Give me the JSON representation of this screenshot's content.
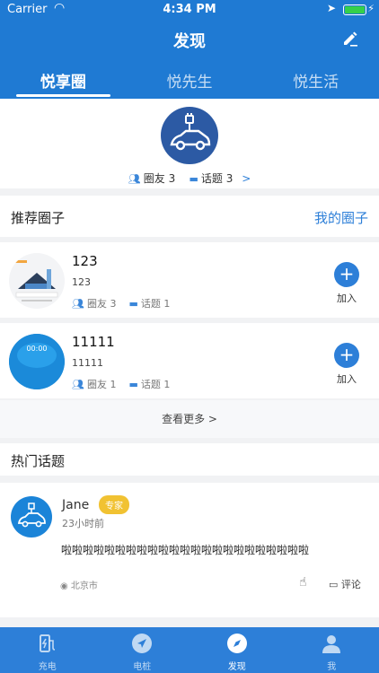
{
  "status": {
    "carrier": "Carrier",
    "time": "4:34 PM"
  },
  "header": {
    "title": "发现"
  },
  "tabs": [
    "悦享圈",
    "悦先生",
    "悦生活"
  ],
  "hero": {
    "members_label": "圈友",
    "members_count": "3",
    "topics_label": "话题",
    "topics_count": "3",
    "more_arrow": ">"
  },
  "recommend": {
    "title": "推荐圈子",
    "my_link": "我的圈子"
  },
  "circles": [
    {
      "name": "123",
      "desc": "123",
      "members": "圈友 3",
      "topics": "话题 1",
      "join_label": "加入"
    },
    {
      "name": "11111",
      "desc": "11111",
      "members": "圈友 1",
      "topics": "话题 1",
      "join_label": "加入",
      "thumb_text": "00:00"
    }
  ],
  "more_link": "查看更多 >",
  "hot": {
    "title": "热门话题"
  },
  "post": {
    "user": "Jane",
    "badge": "专家",
    "time": "23小时前",
    "text": "啦啦啦啦啦啦啦啦啦啦啦啦啦啦啦啦啦啦啦啦啦啦啦",
    "location": "北京市",
    "comment_label": "评论"
  },
  "tabbar": [
    {
      "label": "充电",
      "icon": "charging-station-icon"
    },
    {
      "label": "电桩",
      "icon": "navigation-icon"
    },
    {
      "label": "发现",
      "icon": "compass-icon",
      "active": true
    },
    {
      "label": "我",
      "icon": "user-icon"
    }
  ],
  "colors": {
    "primary": "#1f7ad3",
    "tabbar": "#2d7fd8",
    "badge": "#f1c232",
    "battery": "#35d04b"
  }
}
